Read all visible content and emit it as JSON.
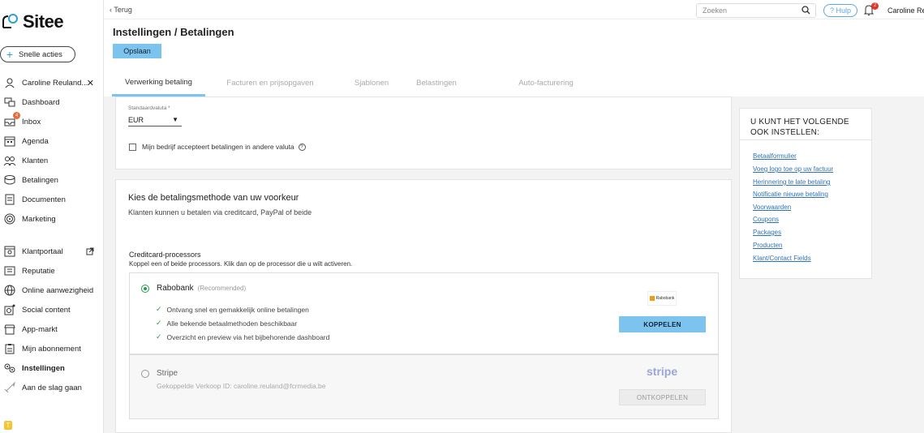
{
  "app": {
    "name": "Sitee"
  },
  "sidebar": {
    "quick_actions": "Snelle acties",
    "items": [
      {
        "label": "Caroline Reuland...",
        "icon": "user-icon"
      },
      {
        "label": "Dashboard",
        "icon": "dashboard-icon"
      },
      {
        "label": "Inbox",
        "icon": "inbox-icon",
        "badge": "4"
      },
      {
        "label": "Agenda",
        "icon": "calendar-icon"
      },
      {
        "label": "Klanten",
        "icon": "clients-icon"
      },
      {
        "label": "Betalingen",
        "icon": "payments-icon"
      },
      {
        "label": "Documenten",
        "icon": "documents-icon"
      },
      {
        "label": "Marketing",
        "icon": "marketing-icon"
      },
      {
        "label": "Klantportaal",
        "icon": "portal-icon"
      },
      {
        "label": "Reputatie",
        "icon": "reputation-icon"
      },
      {
        "label": "Online aanwezigheid",
        "icon": "globe-icon"
      },
      {
        "label": "Social content",
        "icon": "social-icon"
      },
      {
        "label": "App-markt",
        "icon": "store-icon"
      },
      {
        "label": "Mijn abonnement",
        "icon": "subscription-icon"
      },
      {
        "label": "Instellingen",
        "icon": "settings-icon"
      },
      {
        "label": "Aan de slag gaan",
        "icon": "rocket-icon"
      }
    ]
  },
  "topbar": {
    "back": "‹ Terug",
    "search_placeholder": "Zoeken",
    "help": "? Hulp",
    "notifications_count": "2",
    "user": "Caroline Re"
  },
  "header": {
    "title": "Instellingen / Betalingen",
    "save": "Opslaan",
    "tabs": [
      "Verwerking betaling",
      "Facturen en prijsopgaven",
      "Sjablonen",
      "Belastingen",
      "Auto-facturering"
    ]
  },
  "currency": {
    "label": "Standaardvaluta *",
    "value": "EUR",
    "accept_other": "Mijn bedrijf accepteert betalingen in andere valuta"
  },
  "payment_method": {
    "title": "Kies de betalingsmethode van uw voorkeur",
    "subtitle": "Klanten kunnen u betalen via creditcard, PayPal of beide",
    "cc_title": "Creditcard-processors",
    "cc_subtitle": "Koppel een of beide processors. Klik dan op de processor die u wilt activeren.",
    "rabobank": {
      "name": "Rabobank",
      "tag": "(Recommended)",
      "features": [
        "Ontvang snel en gemakkelijk online betalingen",
        "Alle bekende betaalmethoden beschikbaar",
        "Overzicht en preview via het bijbehorende dashboard"
      ],
      "logo_text": "Rabobank",
      "button": "KOPPELEN"
    },
    "stripe": {
      "name": "Stripe",
      "logo_text": "stripe",
      "connected": "Gekoppelde Verkoop ID: caroline.reuland@fcrmedia.be",
      "button": "ONTKOPPELEN"
    }
  },
  "side_panel": {
    "title": "U KUNT HET VOLGENDE OOK INSTELLEN:",
    "links": [
      "Betaalformulier",
      "Voeg logo toe op uw factuur",
      "Herinnering te late betaling",
      "Notificatie nieuwe betaling",
      "Voorwaarden",
      "Coupons",
      "Packages",
      "Producten",
      "Klant/Contact Fields"
    ]
  },
  "colors": {
    "accent": "#7cc4ee",
    "link": "#2f73b8",
    "success": "#2a9d4e"
  }
}
